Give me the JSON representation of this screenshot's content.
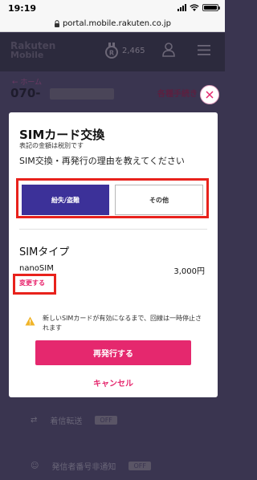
{
  "status_bar": {
    "time": "19:19"
  },
  "browser": {
    "url": "portal.mobile.rakuten.co.jp"
  },
  "header": {
    "logo_line1": "Rakuten",
    "logo_line2": "Mobile",
    "points": "2,465",
    "icons": [
      "points-badge-icon",
      "user-icon",
      "menu-icon"
    ]
  },
  "background_page": {
    "breadcrumb": "← ホーム",
    "phone_prefix": "070-",
    "procedures_link": "各種手続き",
    "rows": [
      {
        "label": "着信転送",
        "toggle": "OFF"
      },
      {
        "label": "発信者番号非通知",
        "toggle": "OFF"
      }
    ]
  },
  "modal": {
    "title": "SIMカード交換",
    "tax_note": "表記の金額は税別です",
    "question": "SIM交換・再発行の理由を教えてください",
    "reasons": [
      {
        "label": "紛失/盗難",
        "selected": true
      },
      {
        "label": "その他",
        "selected": false
      }
    ],
    "sim_type_heading": "SIMタイプ",
    "sim_name": "nanoSIM",
    "sim_price": "3,000円",
    "change_link": "変更する",
    "warning": "新しいSIMカードが有効になるまで、回線は一時停止されます",
    "reissue_button": "再発行する",
    "cancel_link": "キャンセル"
  },
  "colors": {
    "accent_pink": "#e5286e",
    "selected_purple": "#3c3199",
    "highlight_red": "#e8221c",
    "overlay": "#3a3550"
  }
}
